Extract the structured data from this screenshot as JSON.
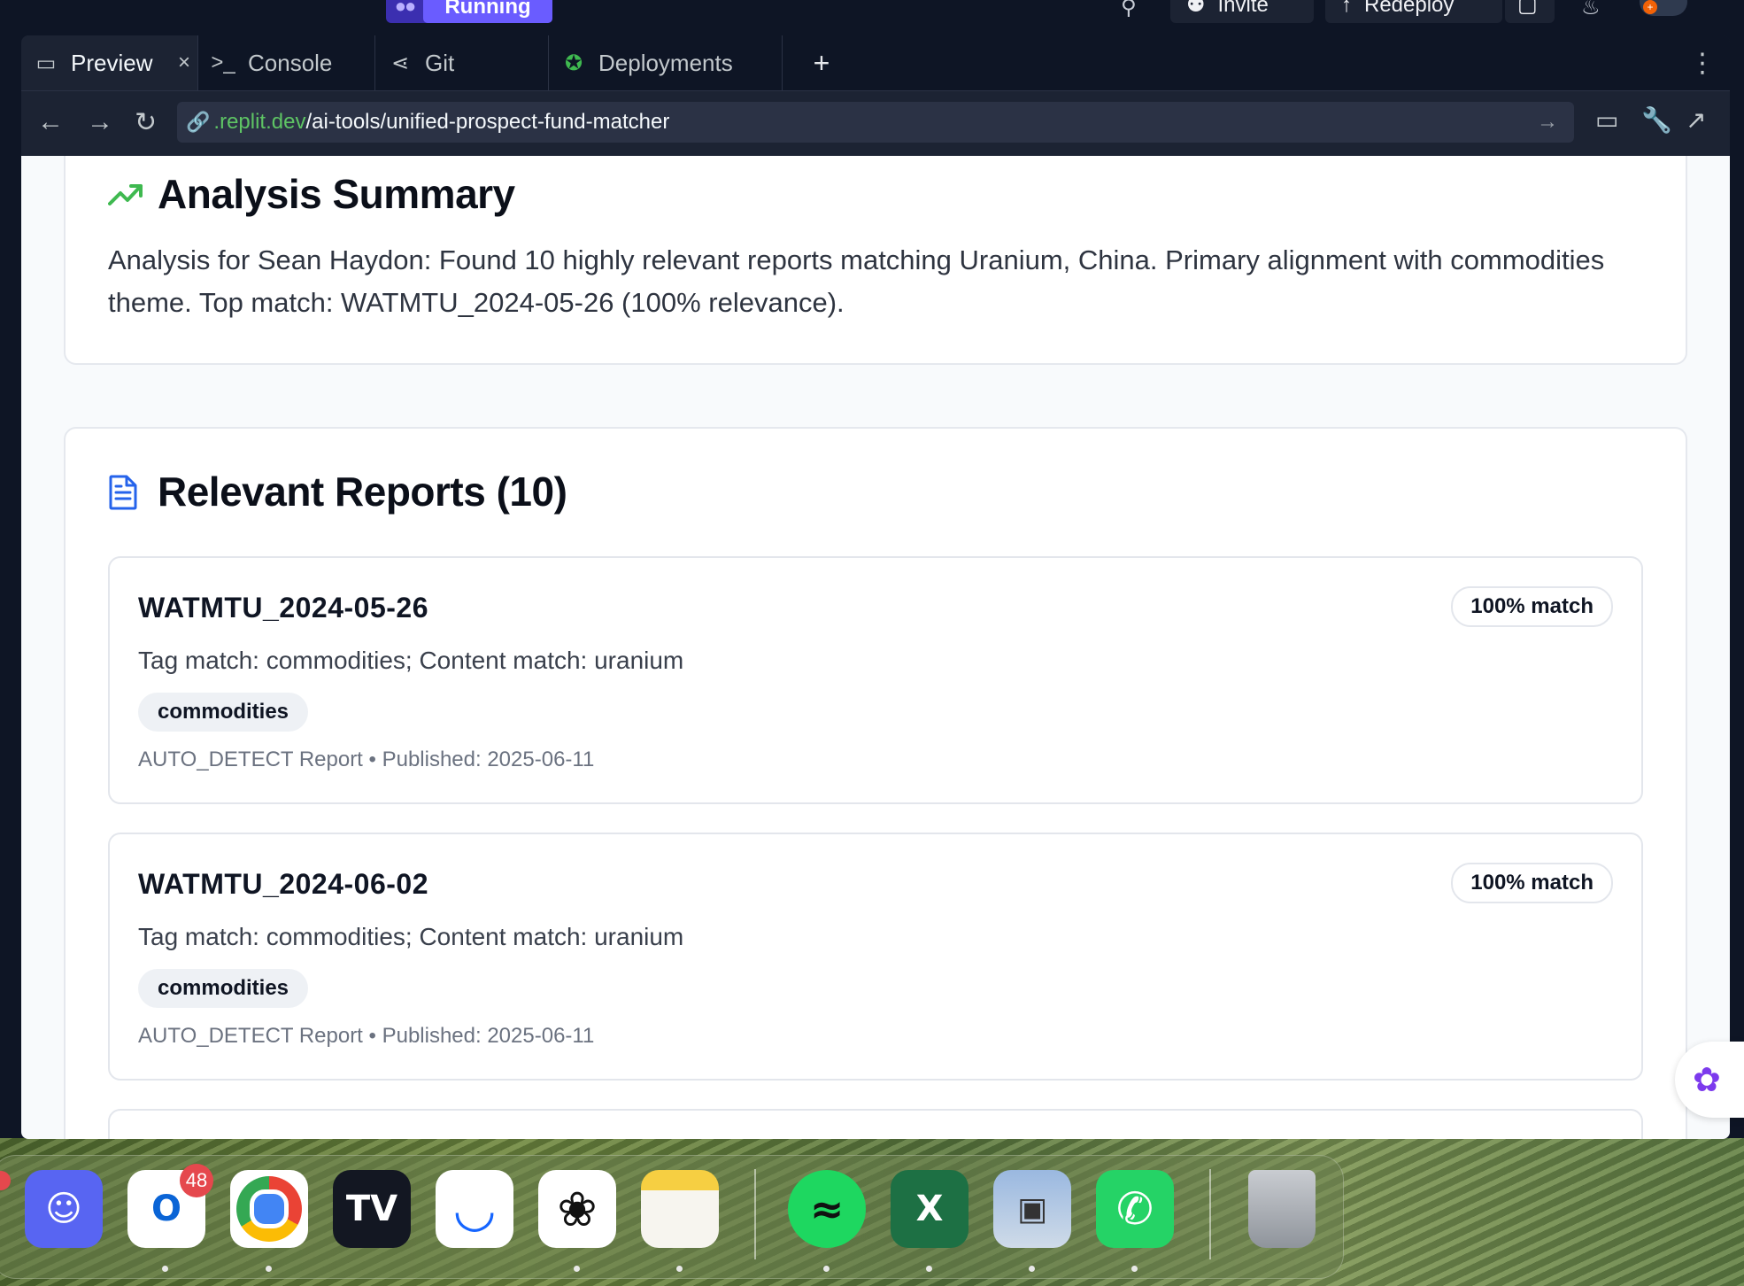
{
  "topbar": {
    "run_label": "Running",
    "invite_label": "Invite",
    "redeploy_label": "Redeploy"
  },
  "tabs": [
    {
      "label": "Preview",
      "icon": "monitor-icon",
      "active": true
    },
    {
      "label": "Console",
      "icon": "terminal-icon"
    },
    {
      "label": "Git",
      "icon": "git-branch-icon"
    },
    {
      "label": "Deployments",
      "icon": "globe-icon"
    }
  ],
  "url": {
    "host": ".replit.dev",
    "path": "/ai-tools/unified-prospect-fund-matcher"
  },
  "summary": {
    "title": "Analysis Summary",
    "text": "Analysis for Sean Haydon: Found 10 highly relevant reports matching Uranium, China. Primary alignment with commodities theme. Top match: WATMTU_2024-05-26 (100% relevance)."
  },
  "reports_section": {
    "title": "Relevant Reports (10)",
    "reports": [
      {
        "title": "WATMTU_2024-05-26",
        "match": "100% match",
        "reason": "Tag match: commodities; Content match: uranium",
        "tag": "commodities",
        "meta": "AUTO_DETECT Report • Published: 2025-06-11"
      },
      {
        "title": "WATMTU_2024-06-02",
        "match": "100% match",
        "reason": "Tag match: commodities; Content match: uranium",
        "tag": "commodities",
        "meta": "AUTO_DETECT Report • Published: 2025-06-11"
      }
    ]
  },
  "dock": {
    "outlook_badge": "48",
    "apps": [
      "Discord",
      "Outlook",
      "Chrome",
      "TradingView",
      "Bumble",
      "ChatGPT",
      "Notes",
      "Spotify",
      "Excel",
      "Preview",
      "WhatsApp",
      "Trash"
    ]
  },
  "colors": {
    "accent_green": "#3fb950",
    "accent_blue": "#2563eb",
    "run_purple": "#6a5cff"
  }
}
